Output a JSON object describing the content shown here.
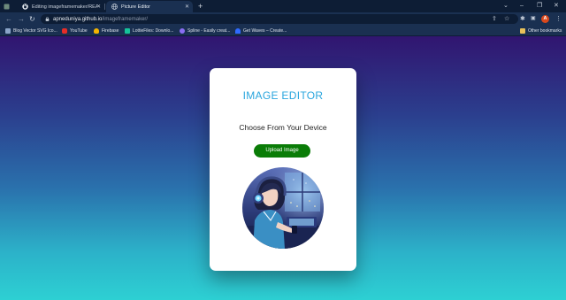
{
  "browser": {
    "tabs": [
      {
        "title": "Editing imageframemaker/README",
        "close": "✕"
      },
      {
        "title": "Picture Editor",
        "close": "✕"
      }
    ],
    "new_tab": "+",
    "window_controls": {
      "minimize": "–",
      "maximize": "❐",
      "close": "✕",
      "tab_search": "⌄"
    },
    "nav": {
      "back": "←",
      "forward": "→",
      "reload": "↻"
    },
    "url": {
      "host": "apneduniya.github.io",
      "path": "/imageframemaker/"
    },
    "profile_initial": "A",
    "bookmarks": [
      {
        "label": "Blog Vector SVG Ico...",
        "color": "#8aa4c8"
      },
      {
        "label": "YouTube",
        "color": "#e52d27"
      },
      {
        "label": "Firebase",
        "color": "#f5b400"
      },
      {
        "label": "LottieFiles: Downlo...",
        "color": "#15c39a"
      },
      {
        "label": "Spline - Easily creat...",
        "color": "#8a6ef2"
      },
      {
        "label": "Get Waves – Create...",
        "color": "#2f6bff"
      }
    ],
    "other_bookmarks": {
      "label": "Other bookmarks",
      "color": "#e8c15a"
    }
  },
  "page": {
    "title": "IMAGE EDITOR",
    "subtitle": "Choose From Your Device",
    "upload_label": "Upload Image"
  },
  "colors": {
    "accent": "#2aa6de",
    "button": "#0a7c07",
    "background_top": "#311570",
    "background_bottom": "#2dd0d3"
  }
}
